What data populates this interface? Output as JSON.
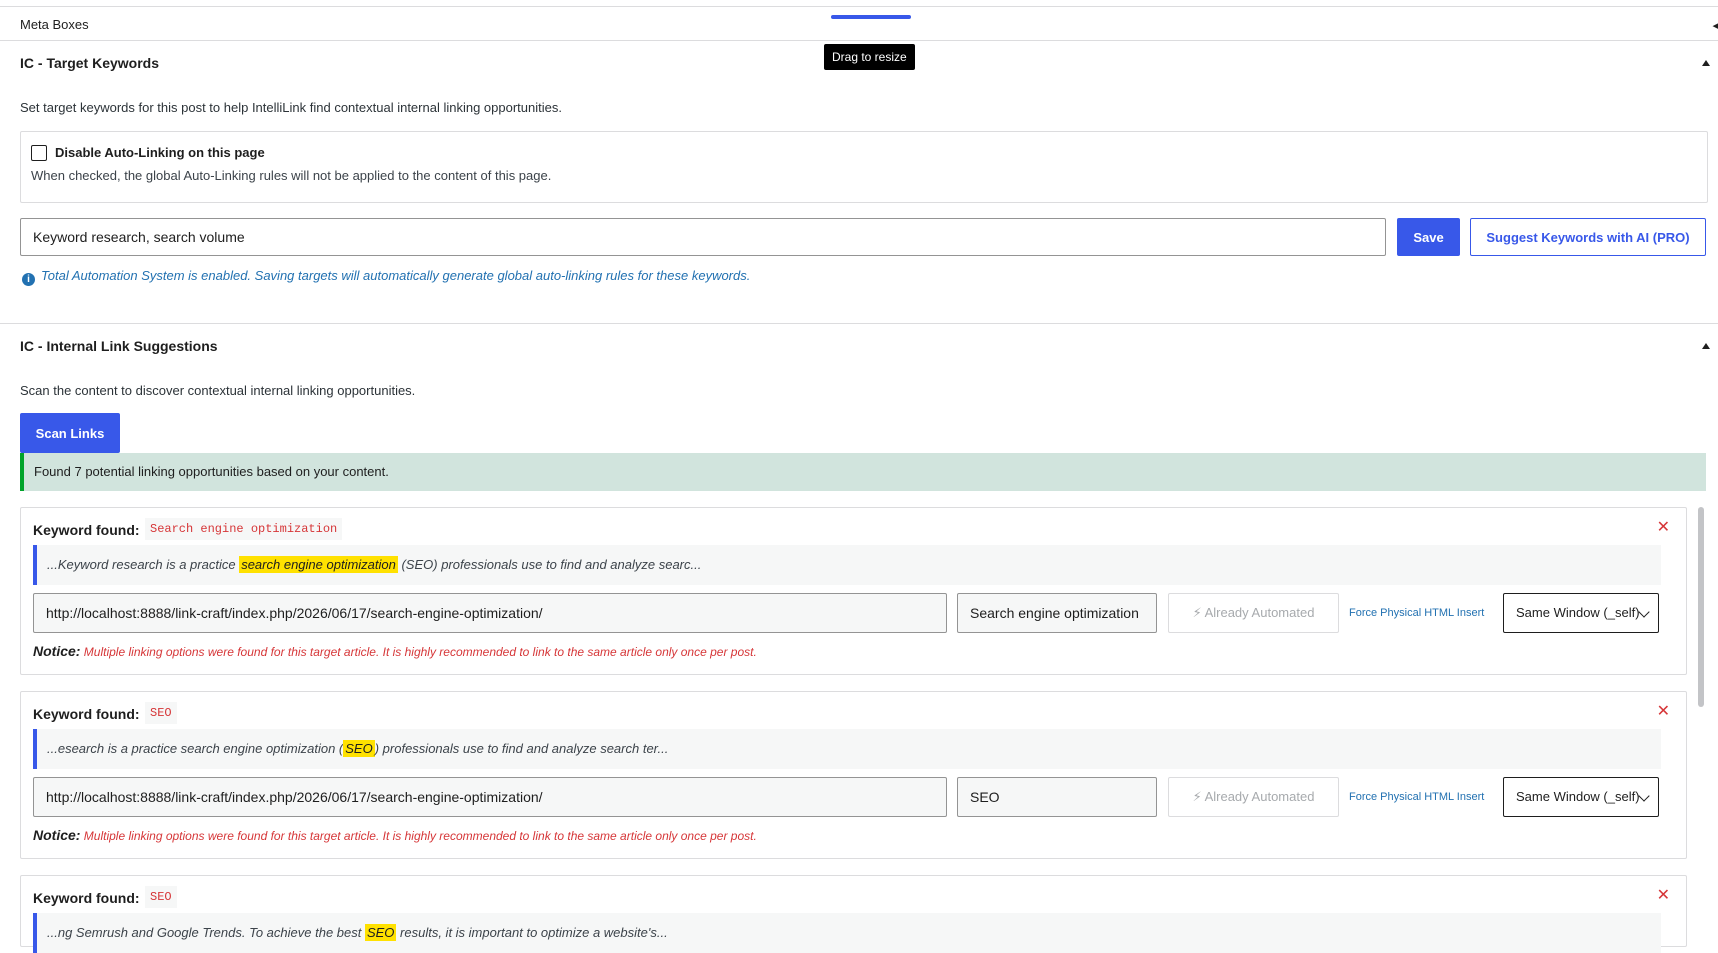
{
  "meta_boxes": {
    "title": "Meta Boxes",
    "tooltip": "Drag to resize",
    "corner_glyph": "◂"
  },
  "target_keywords": {
    "title": "IC - Target Keywords",
    "description": "Set target keywords for this post to help IntelliLink find contextual internal linking opportunities.",
    "autolink_label": "Disable Auto-Linking on this page",
    "autolink_help": "When checked, the global Auto-Linking rules will not be applied to the content of this page.",
    "keywords_value": "Keyword research, search volume",
    "save_label": "Save",
    "suggest_label": "Suggest Keywords with AI (PRO)",
    "info_icon": "i",
    "info_text": "Total Automation System is enabled. Saving targets will automatically generate global auto-linking rules for these keywords."
  },
  "link_suggestions": {
    "title": "IC - Internal Link Suggestions",
    "description": "Scan the content to discover contextual internal linking opportunities.",
    "scan_label": "Scan Links",
    "found_text": "Found 7 potential linking opportunities based on your content.",
    "cards": [
      {
        "keyword_found_label": "Keyword found:",
        "keyword": "Search engine optimization",
        "close_glyph": "✕",
        "excerpt_before": "...Keyword research is a practice ",
        "excerpt_highlight": "search engine optimization",
        "excerpt_after": " (SEO) professionals use to find and analyze searc...",
        "url": "http://localhost:8888/link-craft/index.php/2026/06/17/search-engine-optimization/",
        "anchor": "Search engine optimization",
        "automated_label": "⚡ Already Automated",
        "force_label": "Force Physical HTML Insert",
        "target": "Same Window (_self)",
        "notice_label": "Notice:",
        "notice_text": "Multiple linking options were found for this target article. It is highly recommended to link to the same article only once per post."
      },
      {
        "keyword_found_label": "Keyword found:",
        "keyword": "SEO",
        "close_glyph": "✕",
        "excerpt_before": "...esearch is a practice search engine optimization (",
        "excerpt_highlight": "SEO",
        "excerpt_after": ") professionals use to find and analyze search ter...",
        "url": "http://localhost:8888/link-craft/index.php/2026/06/17/search-engine-optimization/",
        "anchor": "SEO",
        "automated_label": "⚡ Already Automated",
        "force_label": "Force Physical HTML Insert",
        "target": "Same Window (_self)",
        "notice_label": "Notice:",
        "notice_text": "Multiple linking options were found for this target article. It is highly recommended to link to the same article only once per post."
      },
      {
        "keyword_found_label": "Keyword found:",
        "keyword": "SEO",
        "close_glyph": "✕",
        "excerpt_before": "...ng Semrush and Google Trends. To achieve the best ",
        "excerpt_highlight": "SEO",
        "excerpt_after": " results, it is important to optimize a website's..."
      }
    ]
  },
  "colors": {
    "accent": "#3858e9",
    "danger": "#d63638",
    "success_bg": "#d1e4dd",
    "success_border": "#00a32a",
    "highlight": "#ffe100",
    "info": "#2271b1"
  }
}
